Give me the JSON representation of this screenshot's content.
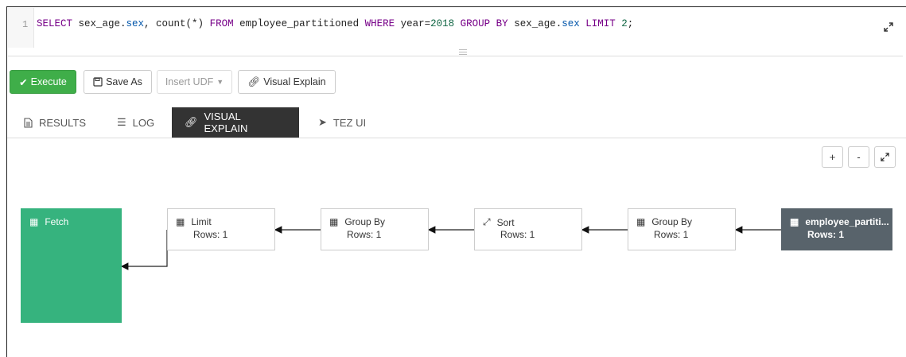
{
  "editor": {
    "line_number": "1",
    "tokens": [
      {
        "t": "SELECT",
        "c": "kw"
      },
      {
        "t": " sex_age.",
        "c": ""
      },
      {
        "t": "sex",
        "c": "prop"
      },
      {
        "t": ", count(*) ",
        "c": ""
      },
      {
        "t": "FROM",
        "c": "kw"
      },
      {
        "t": " employee_partitioned ",
        "c": ""
      },
      {
        "t": "WHERE",
        "c": "kw"
      },
      {
        "t": " year=",
        "c": ""
      },
      {
        "t": "2018",
        "c": "num"
      },
      {
        "t": " ",
        "c": ""
      },
      {
        "t": "GROUP BY",
        "c": "kw"
      },
      {
        "t": " sex_age.",
        "c": ""
      },
      {
        "t": "sex",
        "c": "prop"
      },
      {
        "t": " ",
        "c": ""
      },
      {
        "t": "LIMIT",
        "c": "kw"
      },
      {
        "t": " ",
        "c": ""
      },
      {
        "t": "2",
        "c": "num"
      },
      {
        "t": ";",
        "c": ""
      }
    ]
  },
  "toolbar": {
    "execute": "Execute",
    "save_as": "Save As",
    "insert_udf": "Insert UDF",
    "visual_explain": "Visual Explain"
  },
  "tabs": {
    "results": "RESULTS",
    "log": "LOG",
    "visual_explain": "VISUAL EXPLAIN",
    "tez_ui": "TEZ UI"
  },
  "zoom": {
    "plus": "+",
    "minus": "-"
  },
  "graph": {
    "fetch": {
      "label": "Fetch"
    },
    "nodes": [
      {
        "label": "Limit",
        "rows": "Rows: 1"
      },
      {
        "label": "Group By",
        "rows": "Rows: 1"
      },
      {
        "label": "Sort",
        "rows": "Rows: 1"
      },
      {
        "label": "Group By",
        "rows": "Rows: 1"
      },
      {
        "label": "employee_partiti...",
        "rows": "Rows: 1"
      }
    ]
  },
  "colors": {
    "execute_green": "#3fae49",
    "fetch_green": "#36b37e",
    "table_node_gray": "#58636b",
    "active_tab": "#333333"
  }
}
